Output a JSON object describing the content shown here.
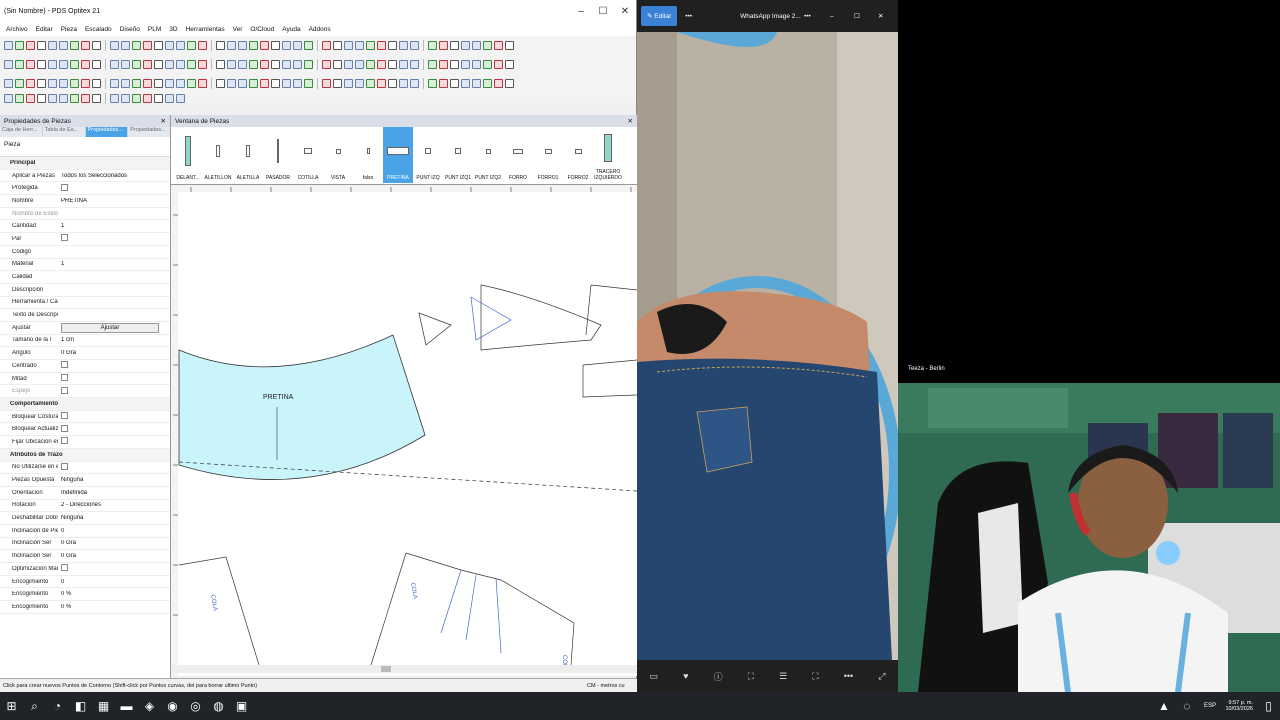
{
  "cad": {
    "title": "(Sin Nombre) - PDS Optitex 21",
    "menu": [
      "Archivo",
      "Editar",
      "Pieza",
      "Escalado",
      "Diseño",
      "PLM",
      "3D",
      "Herramientas",
      "Ver",
      "O/Cloud",
      "Ayuda",
      "Addons"
    ],
    "props_panel": {
      "title": "Propiedades de Piezas",
      "tabs": [
        "Caja de Herr...",
        "Tabla de Es...",
        "Propiedades...",
        "Propiedades..."
      ],
      "pieza_label": "Pieza",
      "rows": [
        {
          "type": "cat",
          "k": "Principal"
        },
        {
          "k": "Aplicar a Piezas",
          "v": "Todos los Seleccionados"
        },
        {
          "k": "Protegida",
          "chk": true
        },
        {
          "k": "Nombre",
          "v": "PRETINA"
        },
        {
          "k": "Nombre de Estilo",
          "dis": true
        },
        {
          "k": "Cantidad",
          "v": "1"
        },
        {
          "k": "Par",
          "chk": true
        },
        {
          "k": "Código"
        },
        {
          "k": "Material",
          "v": "1"
        },
        {
          "k": "Calidad"
        },
        {
          "k": "Descripción"
        },
        {
          "k": "Herramienta / Ca"
        },
        {
          "k": "Texto de Descripc"
        },
        {
          "k": "Ajustar",
          "btn": "Ajustar"
        },
        {
          "k": "Tamaño de la l",
          "v": "1 cm"
        },
        {
          "k": "Angulo",
          "v": "0 Gra"
        },
        {
          "k": "Centrado",
          "chk": true
        },
        {
          "k": "Mitad",
          "chk": true
        },
        {
          "k": "Espejo",
          "dis": true,
          "chk": true
        },
        {
          "type": "cat",
          "k": "Comportamiento"
        },
        {
          "k": "Bloquear Costura",
          "chk": true
        },
        {
          "k": "Bloquear Actualiz",
          "chk": true
        },
        {
          "k": "Fijar Ubicación er",
          "chk": true
        },
        {
          "type": "cat",
          "k": "Atributos de Trazo"
        },
        {
          "k": "No Utilizarse en e",
          "chk": true
        },
        {
          "k": "Piezas Opuesta",
          "v": "Ninguna"
        },
        {
          "k": "Orientación",
          "v": "Indefinida"
        },
        {
          "k": "Rotación",
          "v": "2 - Direcciones"
        },
        {
          "k": "Deshabilitar Dobl",
          "v": "Ninguna"
        },
        {
          "k": "Inclinación de Pie",
          "v": "0"
        },
        {
          "k": "Inclinación Ser",
          "v": "0 Gra"
        },
        {
          "k": "Inclinación Ser",
          "v": "0 Gra"
        },
        {
          "k": "Optimización Mar",
          "chk": true
        },
        {
          "k": "Encogimiento",
          "v": "0"
        },
        {
          "k": "Encogimiento",
          "v": "0 %"
        },
        {
          "k": "Encogimiento",
          "v": "0 %"
        }
      ]
    },
    "pieces_window": {
      "title": "Ventana de Piezas",
      "pieces": [
        "DELANT...",
        "ALETILLON",
        "ALETILLA",
        "PASADOR",
        "COTILLA",
        "VISTA",
        "falso",
        "PRETINA",
        "PUNT IZQ",
        "PUNT IZQ1",
        "PUNT IZQ2",
        "FORRO",
        "FORRO1",
        "FORRO2",
        "TRACERO IZQUIERDO"
      ],
      "selected": "PRETINA"
    },
    "canvas": {
      "piece_name": "PRETINA",
      "cola_labels": [
        "COLA",
        "COLA",
        "COLA"
      ]
    },
    "status": "Click para crear nuevos Puntos de Contorno (Shift-click por Puntos curvas, del para borrar ultimo Punto)",
    "units": "CM - metros cu"
  },
  "photo_viewer": {
    "edit_label": "Editar",
    "title": "WhatsApp Image 2..."
  },
  "webcam": {
    "label": "Teeza - Berlin"
  },
  "taskbar": {
    "time": "9:57 p. m.",
    "date": "10/03/2026",
    "lang": "ESP"
  },
  "colors": {
    "piece_fill": "#c8f4fa",
    "selected_blue": "#4aa3e6"
  }
}
